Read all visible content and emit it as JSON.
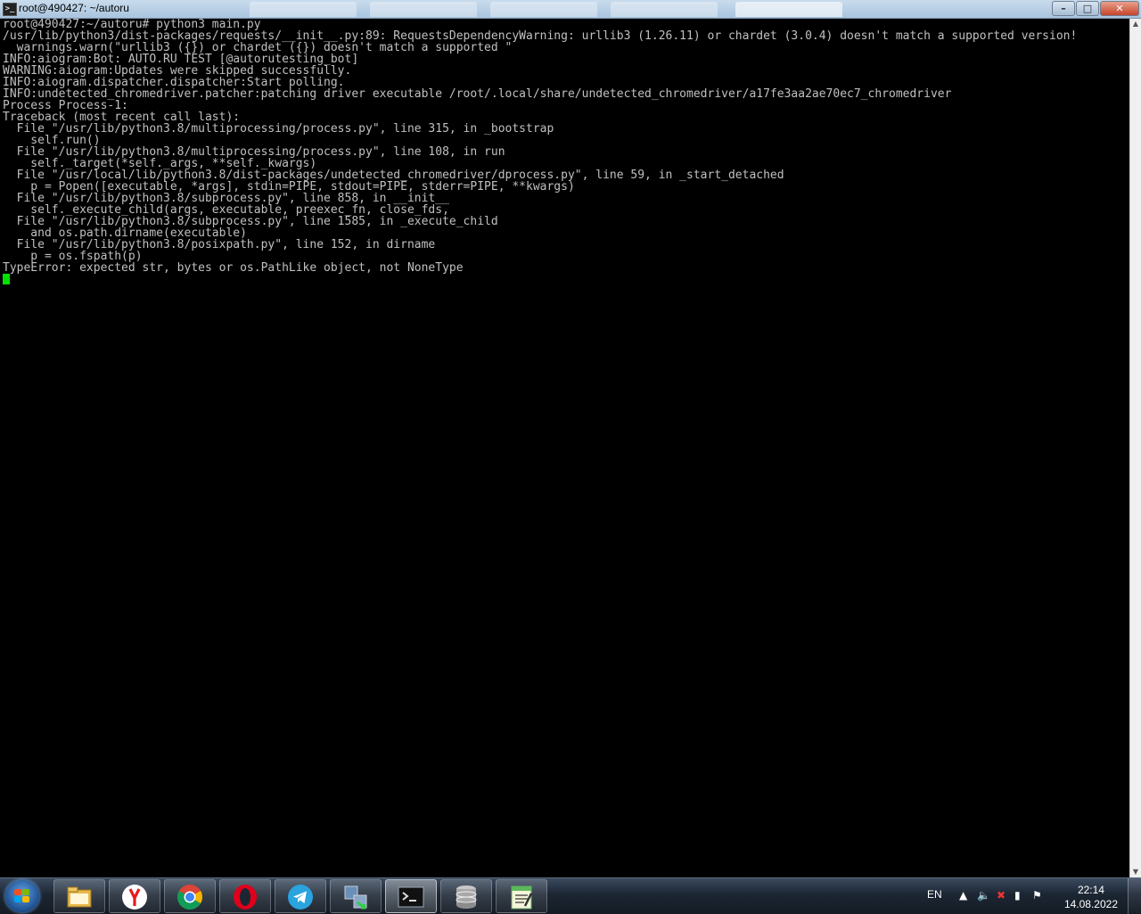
{
  "window": {
    "title": "root@490427: ~/autoru",
    "icon_label": ">_",
    "controls": {
      "minimize": "–",
      "maximize": "□",
      "close": "✕"
    }
  },
  "terminal": {
    "lines": [
      "root@490427:~/autoru# python3 main.py",
      "/usr/lib/python3/dist-packages/requests/__init__.py:89: RequestsDependencyWarning: urllib3 (1.26.11) or chardet (3.0.4) doesn't match a supported version!",
      "  warnings.warn(\"urllib3 ({}) or chardet ({}) doesn't match a supported \"",
      "INFO:aiogram:Bot: AUTO.RU TEST [@autorutesting_bot]",
      "WARNING:aiogram:Updates were skipped successfully.",
      "INFO:aiogram.dispatcher.dispatcher:Start polling.",
      "INFO:undetected_chromedriver.patcher:patching driver executable /root/.local/share/undetected_chromedriver/a17fe3aa2ae70ec7_chromedriver",
      "Process Process-1:",
      "Traceback (most recent call last):",
      "  File \"/usr/lib/python3.8/multiprocessing/process.py\", line 315, in _bootstrap",
      "    self.run()",
      "  File \"/usr/lib/python3.8/multiprocessing/process.py\", line 108, in run",
      "    self._target(*self._args, **self._kwargs)",
      "  File \"/usr/local/lib/python3.8/dist-packages/undetected_chromedriver/dprocess.py\", line 59, in _start_detached",
      "    p = Popen([executable, *args], stdin=PIPE, stdout=PIPE, stderr=PIPE, **kwargs)",
      "  File \"/usr/lib/python3.8/subprocess.py\", line 858, in __init__",
      "    self._execute_child(args, executable, preexec_fn, close_fds,",
      "  File \"/usr/lib/python3.8/subprocess.py\", line 1585, in _execute_child",
      "    and os.path.dirname(executable)",
      "  File \"/usr/lib/python3.8/posixpath.py\", line 152, in dirname",
      "    p = os.fspath(p)",
      "TypeError: expected str, bytes or os.PathLike object, not NoneType"
    ],
    "text_color": "#c0c0c0",
    "background": "#000000",
    "cursor_color": "#00e000"
  },
  "taskbar": {
    "apps": [
      {
        "name": "explorer-icon"
      },
      {
        "name": "yandex-browser-icon"
      },
      {
        "name": "chrome-icon"
      },
      {
        "name": "opera-icon"
      },
      {
        "name": "telegram-icon"
      },
      {
        "name": "file-transfer-icon"
      },
      {
        "name": "terminal-icon",
        "active": true
      },
      {
        "name": "database-icon"
      },
      {
        "name": "notepad-icon"
      }
    ],
    "language": "EN",
    "time": "22:14",
    "date": "14.08.2022"
  }
}
